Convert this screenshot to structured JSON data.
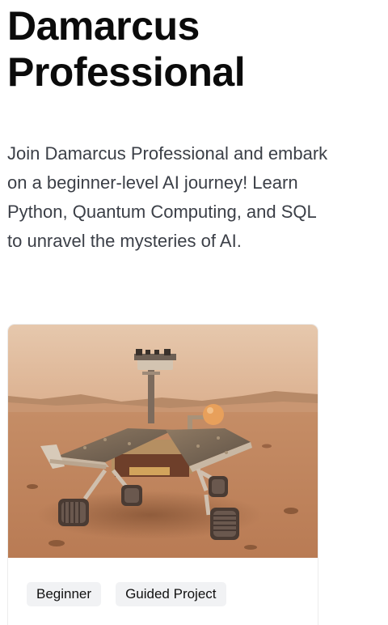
{
  "course": {
    "title_line1": "Damarcus",
    "title_line2": "Professional",
    "description": "Join Damarcus Professional and embark on a beginner-level AI journey! Learn Python, Quantum Computing, and SQL to unravel the mysteries of AI."
  },
  "card": {
    "image_subject": "mars-rover-image",
    "tags": [
      "Beginner",
      "Guided Project"
    ]
  },
  "colors": {
    "title": "#0b0b0b",
    "body_text": "#3b3f47",
    "tag_background": "#f1f2f4",
    "card_border": "#ececec"
  }
}
